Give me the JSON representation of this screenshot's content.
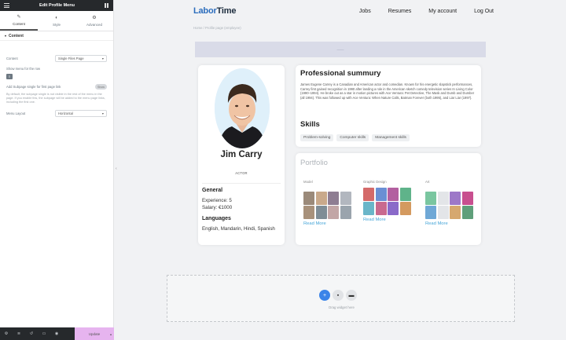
{
  "panel": {
    "title": "Edit Profile Menu",
    "tabs": [
      {
        "label": "Content",
        "icon": "pencil-icon"
      },
      {
        "label": "Style",
        "icon": "half-circle-icon"
      },
      {
        "label": "Advanced",
        "icon": "gear-icon"
      }
    ],
    "section": "Content",
    "content_label": "Content",
    "content_value": "Single Files Page",
    "show_menu_label": "Show menu for the row",
    "add_subpage_label": "Add Subpage single for first page link",
    "add_subpage_toggle": "Show",
    "note": "By default, the subpage single is not visible in the rest of the menu in the page. If you enable this, the subpage will be added to the menu page links, including the first one.",
    "menu_layout_label": "Menu Layout",
    "menu_layout_value": "Horizontal",
    "update_label": "Update"
  },
  "site": {
    "logo_part1": "Labor",
    "logo_part2": "Time",
    "nav": [
      "Jobs",
      "Resumes",
      "My account",
      "Log Out"
    ],
    "breadcrumb": "Home  /  Profile page (employee)",
    "tabbar_label": "——"
  },
  "profile": {
    "name": "Jim Carry",
    "role": "ACTOR",
    "general_heading": "General",
    "experience": "Experience: 5",
    "salary": "Salary: €1000",
    "languages_heading": "Languages",
    "languages": "English, Mandarin, Hindi, Spanish"
  },
  "summary": {
    "title": "Professional summury",
    "text": "James Eugene Carrey is a Canadian and American actor and comedian. Known for his energetic slapstick performances, Carrey first gained recognition in 1990 after landing a role in the American sketch comedy television series In Living Color (1990–1994). He broke out as a star in motion pictures with Ace Ventura: Pet Detective, The Mask and Dumb and Dumber (all 1994). This was followed up with Ace Ventura: When Nature Calls, Batman Forever (both 1995), and Liar Liar (1997).",
    "skills_title": "Skills",
    "skills": [
      "Problem-solving",
      "Computer skills",
      "Management skills"
    ]
  },
  "portfolio": {
    "title": "Portfolio",
    "columns": [
      {
        "label": "Model",
        "more": "Read More"
      },
      {
        "label": "Graphic Design",
        "more": "Read More"
      },
      {
        "label": "Art",
        "more": "Read More"
      }
    ]
  },
  "drop": {
    "text": "Drag widget here"
  }
}
